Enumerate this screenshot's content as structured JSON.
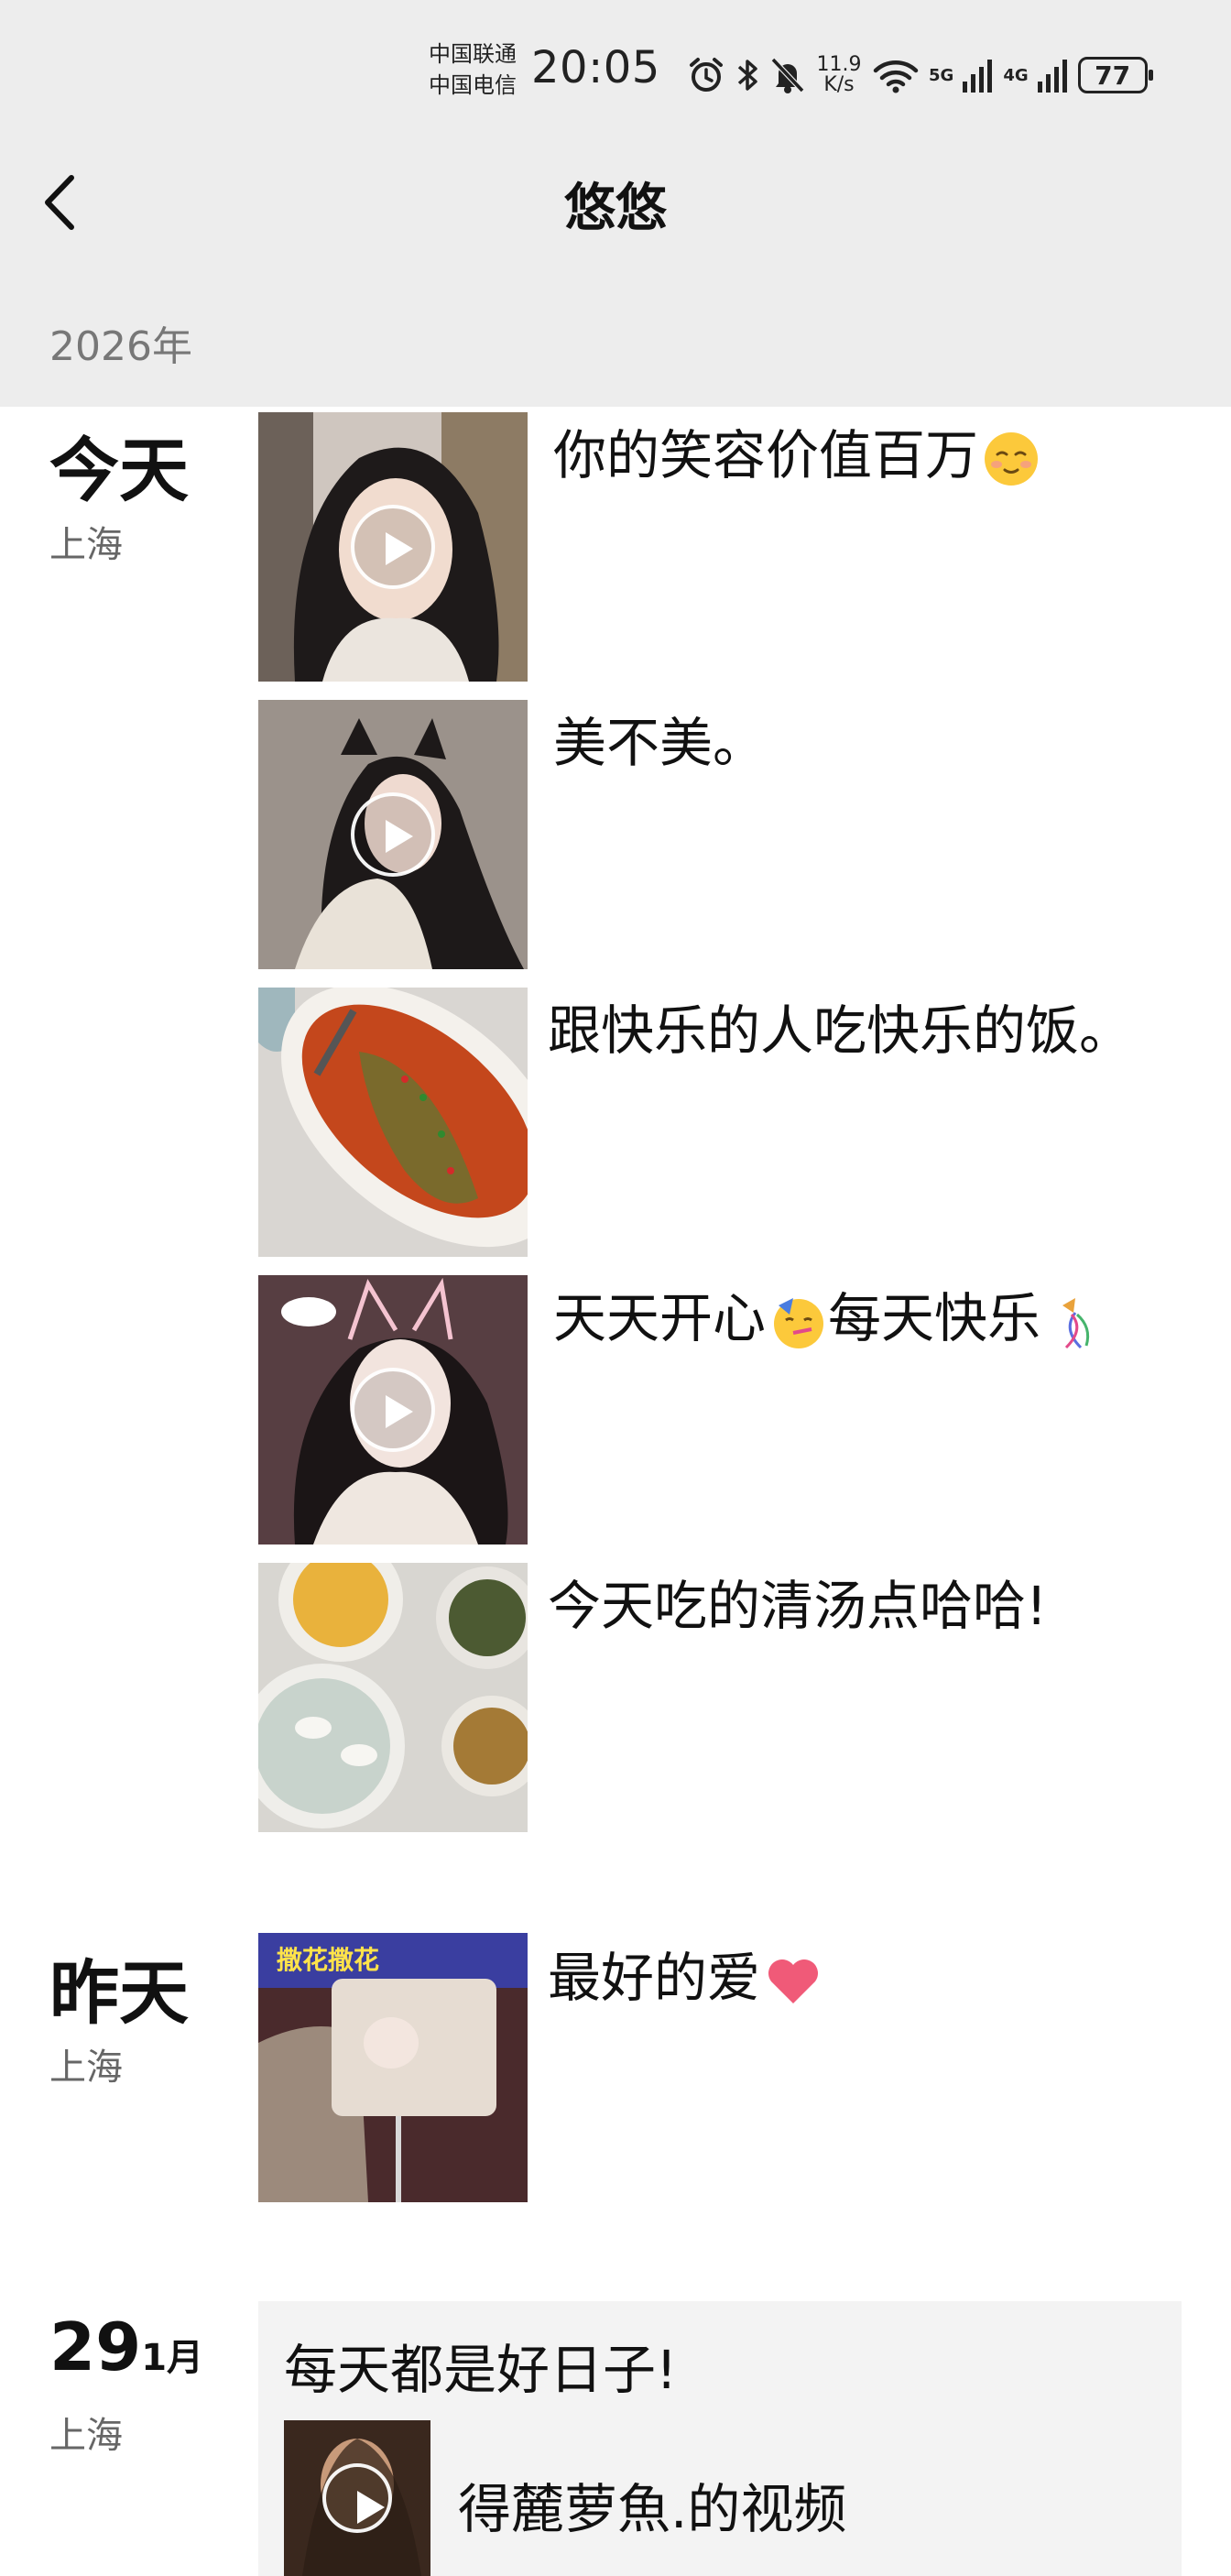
{
  "status": {
    "carrier1": "中国联通",
    "carrier2": "中国电信",
    "time": "20:05",
    "net_speed_value": "11.9",
    "net_speed_unit": "K/s",
    "signal1": "5G",
    "signal2": "4G",
    "battery": "77"
  },
  "nav": {
    "title": "悠悠"
  },
  "year": "2026年",
  "groups": [
    {
      "day": "今天",
      "location": "上海",
      "posts": [
        {
          "caption": "你的笑容价值百万",
          "emoji": "smiling-face-icon",
          "video": true
        },
        {
          "caption": "美不美。",
          "video": true
        },
        {
          "caption": "跟快乐的人吃快乐的饭。",
          "video": false
        },
        {
          "caption": "天天开心",
          "emoji": "party-face-icon",
          "caption_b": "每天快乐",
          "emoji_b": "confetti-ball-icon",
          "video": true
        },
        {
          "caption": "今天吃的清汤点哈哈!",
          "video": false
        }
      ]
    },
    {
      "day": "昨天",
      "location": "上海",
      "posts": [
        {
          "caption": "最好的爱",
          "emoji": "heart-icon",
          "video": false,
          "thumb_text": "撒花撒花"
        }
      ]
    },
    {
      "day_number": "29",
      "month": "1月",
      "location": "上海",
      "card": {
        "text": "每天都是好日子!",
        "shared": "得麓萝魚.的视频",
        "video": true
      }
    }
  ],
  "colors": {
    "header_bg": "#ededed",
    "card_bg": "#f3f3f3",
    "muted": "#777777"
  }
}
